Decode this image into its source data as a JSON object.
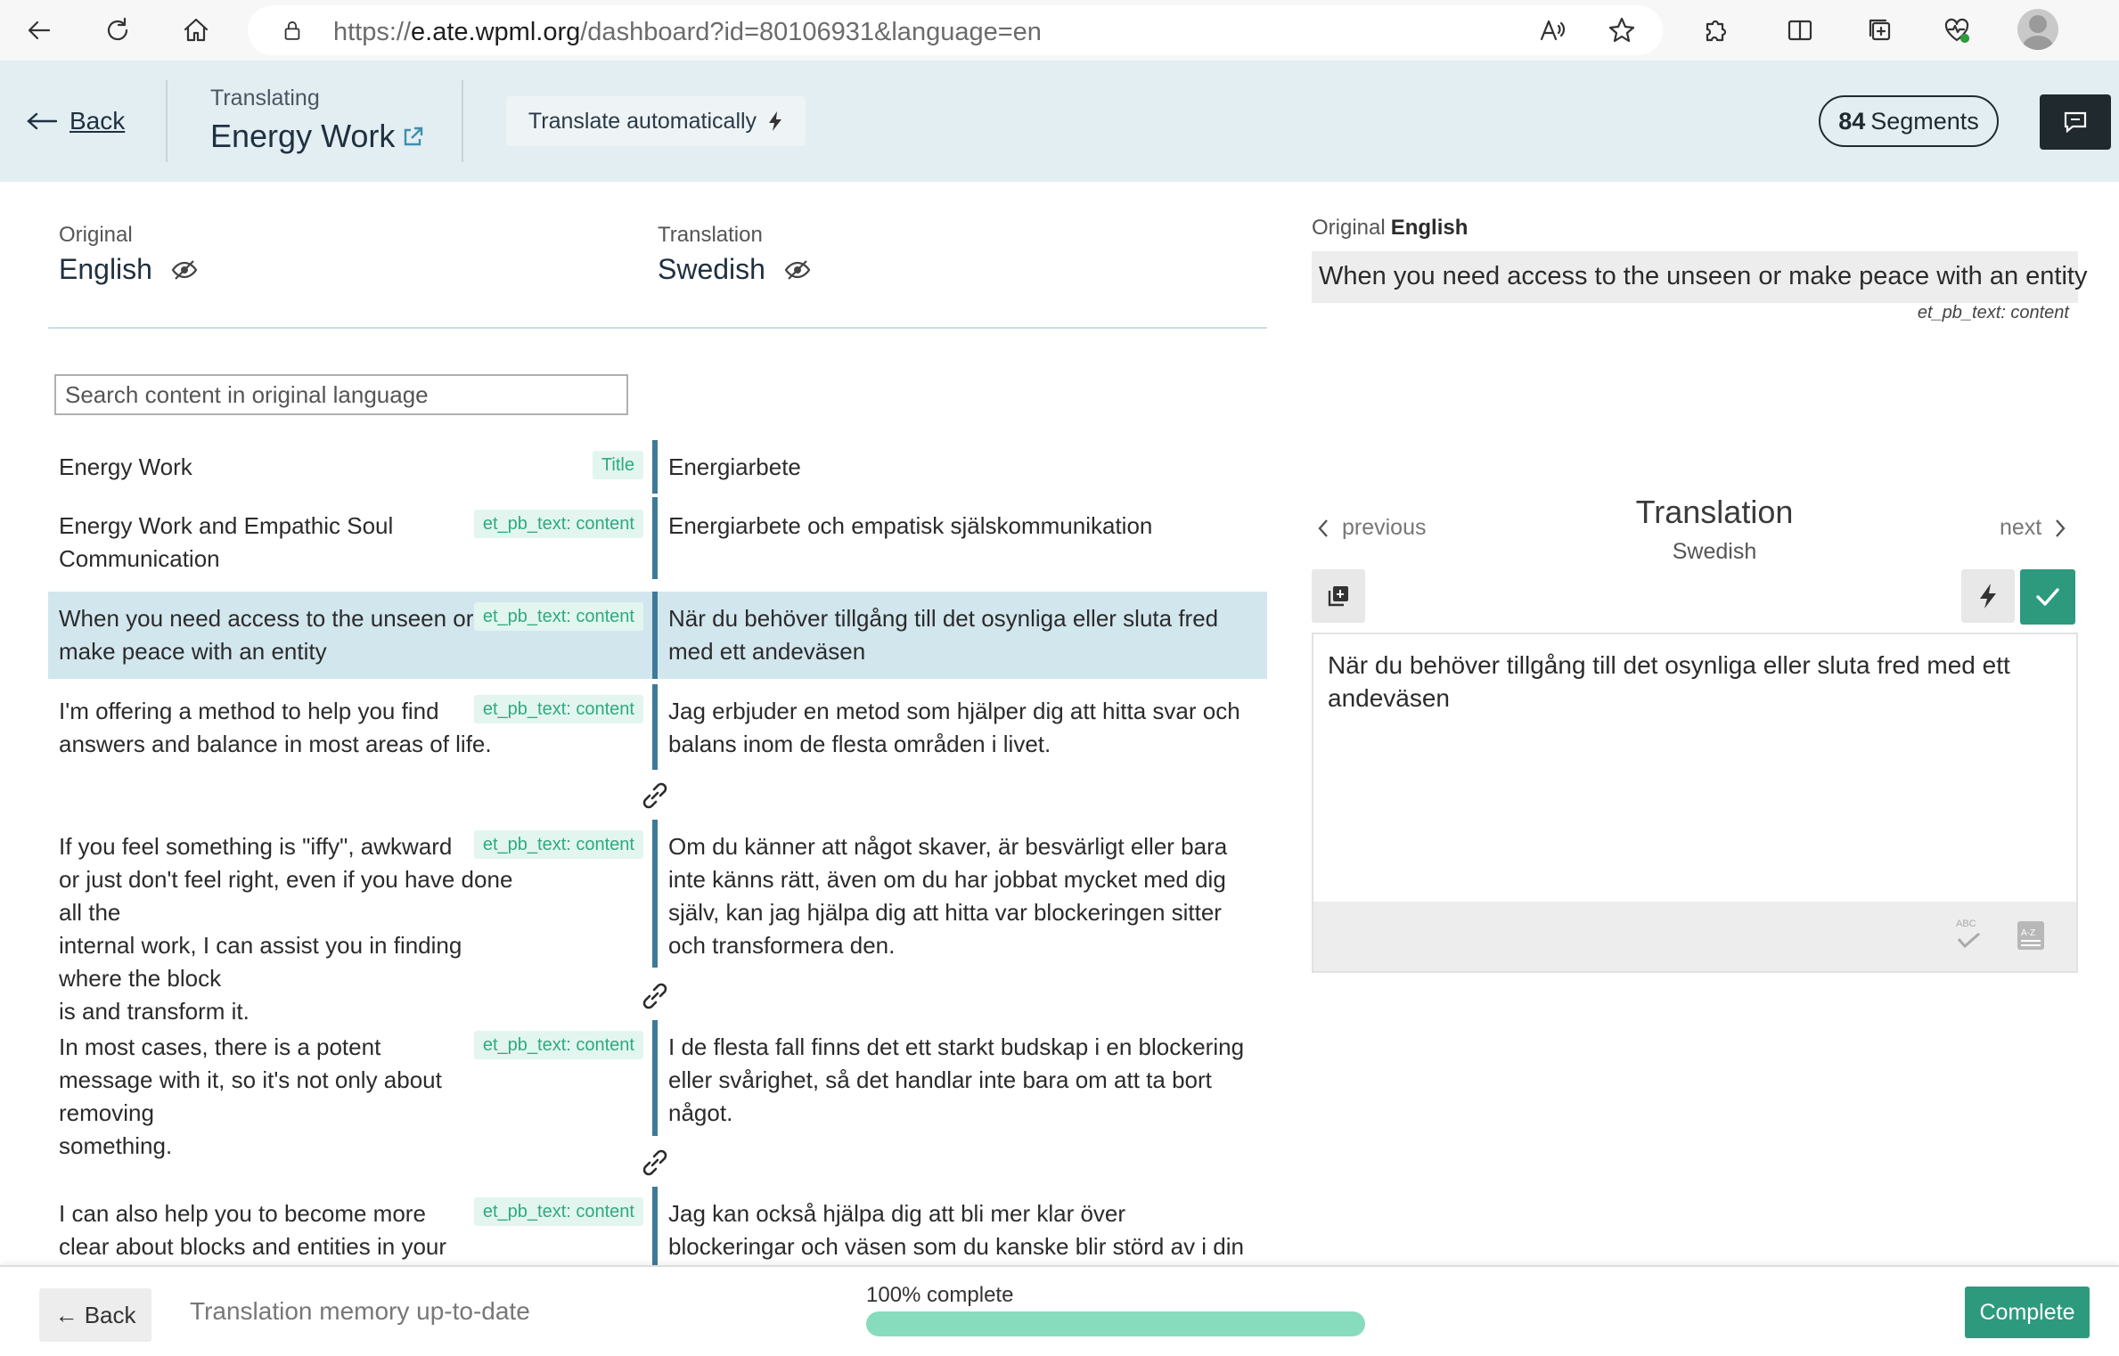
{
  "browser": {
    "url_prefix": "https://",
    "url_domain": "e.ate.wpml.org",
    "url_path": "/dashboard?id=80106931&language=en",
    "icons": [
      "back-icon",
      "refresh-icon",
      "home-icon",
      "lock-icon",
      "read-aloud-icon",
      "favorite-star-icon",
      "extensions-icon",
      "split-screen-icon",
      "collections-icon",
      "browser-essentials-icon",
      "profile-avatar"
    ]
  },
  "header": {
    "back_label": "Back",
    "translating_label": "Translating",
    "job_title": "Energy Work",
    "auto_translate_label": "Translate automatically",
    "segments_count": "84",
    "segments_label": "Segments"
  },
  "columns": {
    "original_small": "Original",
    "original_lang": "English",
    "translation_small": "Translation",
    "translation_lang": "Swedish"
  },
  "search": {
    "placeholder": "Search content in original language"
  },
  "segments": [
    {
      "source_lines": [
        "Energy Work"
      ],
      "tag": "Title",
      "target_lines": [
        "Energiarbete"
      ]
    },
    {
      "source_lines": [
        "Energy Work and Empathic Soul",
        "Communication"
      ],
      "tag": "et_pb_text: content",
      "target_lines": [
        "Energiarbete och empatisk själskommunikation"
      ]
    },
    {
      "source_lines": [
        "When you need access to the unseen or",
        "make peace with an entity"
      ],
      "tag": "et_pb_text: content",
      "target_lines": [
        "När du behöver tillgång till det osynliga eller sluta fred",
        "med ett andeväsen"
      ],
      "active": true
    },
    {
      "source_lines": [
        "I'm offering a method to help you find",
        "answers and balance in most areas of life."
      ],
      "tag": "et_pb_text: content",
      "target_lines": [
        "Jag erbjuder en metod som hjälper dig att hitta svar och",
        "balans inom de flesta områden i livet."
      ]
    },
    {
      "source_lines": [
        "If you feel something is \"iffy\", awkward",
        "or just don't feel right, even if you have done all the",
        "internal work, I can assist you in finding where the block",
        "is and transform it."
      ],
      "tag": "et_pb_text: content",
      "target_lines": [
        "Om du känner att något skaver, är besvärligt eller bara",
        "inte känns rätt, även om du har jobbat mycket med dig",
        "själv, kan jag hjälpa dig att hitta var blockeringen sitter",
        "och transformera den."
      ]
    },
    {
      "source_lines": [
        "In most cases, there is a potent",
        "message with it, so it's not only about removing",
        "something."
      ],
      "tag": "et_pb_text: content",
      "target_lines": [
        "I de flesta fall finns det ett starkt budskap i en blockering",
        "eller svårighet, så det handlar inte bara om att ta bort",
        "något."
      ]
    },
    {
      "source_lines": [
        "I can also help you to become more",
        "clear about blocks and entities in your environment,"
      ],
      "tag": "et_pb_text: content",
      "target_lines": [
        "Jag kan också hjälpa dig att bli mer klar över",
        "blockeringar och väsen som du kanske blir störd av i din"
      ]
    }
  ],
  "right_panel": {
    "original_label": "Original",
    "original_lang": "English",
    "original_text": "When you need access to the unseen or make peace with an entity",
    "original_meta": "et_pb_text: content",
    "previous_label": "previous",
    "next_label": "next",
    "translation_title": "Translation",
    "translation_lang": "Swedish",
    "editor_text": "När du behöver tillgång till det osynliga eller sluta fred med ett andeväsen"
  },
  "footer": {
    "back_label": "Back",
    "tm_status": "Translation memory up-to-date",
    "progress_label": "100% complete",
    "progress_value": 1.0,
    "complete_label": "Complete"
  },
  "colors": {
    "header_bg": "#e2eef2",
    "active_row": "#d2e6ee",
    "tag_bg": "#e3f5ef",
    "tag_text": "#2eaa7f",
    "accent_green": "#2d9a7e",
    "progress_fill": "#86dcbd",
    "segment_bar": "#3d7a9a"
  }
}
